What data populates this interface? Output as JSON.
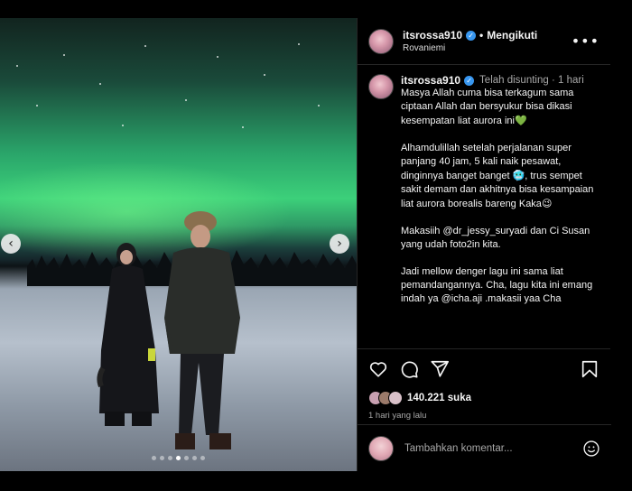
{
  "post": {
    "username": "itsrossa910",
    "follow_label": "Mengikuti",
    "location": "Rovaniemi",
    "more_icon": "more-horizontal-icon",
    "photo_alt": "Two people standing on snow under the northern lights",
    "carousel": {
      "count": 7,
      "active": 3
    }
  },
  "caption": {
    "username": "itsrossa910",
    "edited_label": "Telah disunting",
    "age": "1 hari",
    "paragraphs": [
      "Masya Allah cuma bisa terkagum sama ciptaan Allah dan bersyukur bisa dikasi kesempatan liat aurora ini",
      "Alhamdulillah setelah perjalanan super panjang 40 jam, 5 kali naik pesawat, dinginnya banget banget",
      "Makasiih @dr_jessy_suryadi dan Ci Susan yang udah foto2in kita.",
      "Jadi mellow denger lagu ini sama liat pemandangannya. Cha, lagu kita ini emang indah ya @icha.aji .makasii yaa Cha"
    ],
    "p2_tail": ", trus sempet sakit demam dan akhitnya bisa kesampaian liat aurora borealis bareng Kaka",
    "emoji_green_heart": "💚",
    "emoji_cold": "🥶",
    "emoji_smile": "😉"
  },
  "engagement": {
    "likes_count": "140.221",
    "likes_word": "suka",
    "time_ago": "1 hari yang lalu"
  },
  "comment": {
    "placeholder": "Tambahkan komentar..."
  },
  "colors": {
    "accent_verified": "#3897f0",
    "background": "#000000",
    "border": "#262626"
  }
}
